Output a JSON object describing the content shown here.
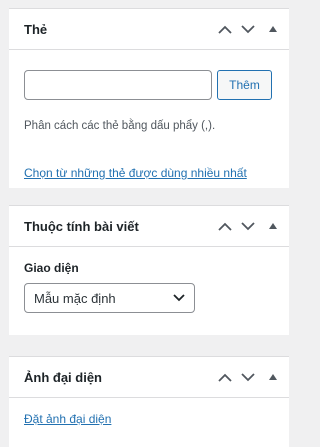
{
  "tags_panel": {
    "title": "Thẻ",
    "input_value": "",
    "add_button": "Thêm",
    "help": "Phân cách các thẻ bằng dấu phẩy (,).",
    "most_used_link": "Chọn từ những thẻ được dùng nhiều nhất"
  },
  "attributes_panel": {
    "title": "Thuộc tính bài viết",
    "template_label": "Giao diện",
    "template_value": "Mẫu mặc định"
  },
  "featured_panel": {
    "title": "Ảnh đại diện",
    "set_link": "Đặt ảnh đại diện"
  },
  "icons": {
    "move_up": "chevron-up-icon",
    "move_down": "chevron-down-icon",
    "toggle": "triangle-up-icon"
  }
}
